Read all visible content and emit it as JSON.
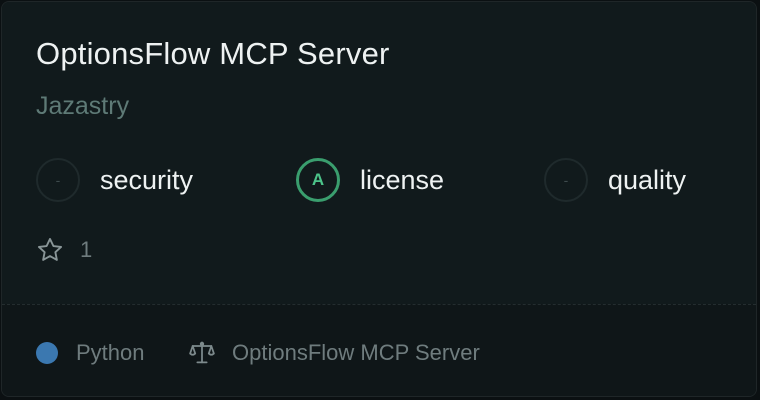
{
  "card": {
    "title": "OptionsFlow MCP Server",
    "author": "Jazastry",
    "scores": {
      "security": {
        "grade": "-",
        "label": "security"
      },
      "license": {
        "grade": "A",
        "label": "license"
      },
      "quality": {
        "grade": "-",
        "label": "quality"
      }
    },
    "stars": {
      "icon": "star-icon",
      "count": "1"
    },
    "footer": {
      "language": {
        "label": "Python",
        "color": "#3b78b0"
      },
      "license": {
        "icon": "scale-icon",
        "label": "OptionsFlow MCP Server"
      }
    }
  },
  "colors": {
    "grade_a": "#3a9e6e",
    "background": "#0f1618"
  }
}
